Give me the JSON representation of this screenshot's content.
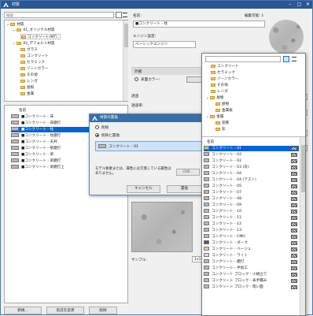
{
  "window": {
    "title": "材質",
    "minimize": "–",
    "maximize": "□",
    "close": "✕"
  },
  "search": {
    "placeholder": "検索"
  },
  "tree": {
    "items": [
      {
        "label": "材質"
      },
      {
        "label": "01_オリジナル材質"
      },
      {
        "label": "コンクリート(MT)"
      },
      {
        "label": "02_デフォルト材質"
      },
      {
        "label": "ガラス"
      },
      {
        "label": "コンクリート"
      },
      {
        "label": "セラミック"
      },
      {
        "label": "ゾーンカラー"
      },
      {
        "label": "その他"
      },
      {
        "label": "レンガ"
      },
      {
        "label": "屋根"
      },
      {
        "label": "金属"
      }
    ]
  },
  "list": {
    "header": "名前",
    "items": [
      {
        "label": "■コンクリート - 床"
      },
      {
        "label": "■コンクリート - 床磨打"
      },
      {
        "label": "■コンクリート - 柱",
        "selected": true
      },
      {
        "label": "■コンクリート - 柱磨打"
      },
      {
        "label": "■コンクリート - 天井"
      },
      {
        "label": "■コンクリート - 壁磨打"
      },
      {
        "label": "■コンクリート - 梁"
      },
      {
        "label": "■コンクリート - 梁磨打"
      },
      {
        "label": "■コンクリート - 梁磨打上"
      }
    ]
  },
  "bottom": {
    "new": "新規...",
    "rename": "名前を変更",
    "delete": "削除"
  },
  "right": {
    "name_label": "名前:",
    "name_value": "■コンクリート - 柱",
    "count_label": "編集可能: 1",
    "engine_label": "エンジン設定:",
    "engine_value": "ベーシックエンジン",
    "appearance": "外観",
    "surface_color": "表面カラー:",
    "transparency": "透過",
    "transparency_rate": "透過率:",
    "sample_label": "サンプル:",
    "sample_value": "1x1",
    "values": [
      "49",
      "72",
      "0",
      "77"
    ]
  },
  "dialog": {
    "title": "材質の置換",
    "delete_label": "削除",
    "replace_label": "削除と置換:",
    "replace_value": "コンクリート - 01",
    "note": "モデル要素または、属性には欠落している属性はありません。",
    "browse": "詳細...",
    "cancel": "キャンセル",
    "ok": "置換"
  },
  "popup": {
    "folders": [
      {
        "label": "コンクリート"
      },
      {
        "label": "セラミック"
      },
      {
        "label": "ゾーンカラー"
      },
      {
        "label": "その他"
      },
      {
        "label": "レンガ"
      },
      {
        "label": "屋根"
      },
      {
        "label": "屋根"
      },
      {
        "label": "金属板"
      },
      {
        "label": "金属"
      },
      {
        "label": "装飾"
      },
      {
        "label": "非"
      }
    ],
    "header": "名前",
    "items": [
      {
        "label": "コンクリート - 01",
        "selected": true
      },
      {
        "label": "コンクリート - 02"
      },
      {
        "label": "コンクリート - 02"
      },
      {
        "label": "コンクリート - 03 (灰)"
      },
      {
        "label": "コンクリート - 04"
      },
      {
        "label": "コンクリート - 04 (アスン)"
      },
      {
        "label": "コンクリート - 05"
      },
      {
        "label": "コンクリート - 07"
      },
      {
        "label": "コンクリート - 08"
      },
      {
        "label": "コンクリート - 09"
      },
      {
        "label": "コンクリート - 10"
      },
      {
        "label": "コンクリート - 11"
      },
      {
        "label": "コンクリート - 12"
      },
      {
        "label": "コンクリート - 13"
      },
      {
        "label": "コンクリート - CMU"
      },
      {
        "label": "コンクリート - ダーク"
      },
      {
        "label": "コンクリート - ベージュ"
      },
      {
        "label": "コンクリート - ライト"
      },
      {
        "label": "コンクリート - 磨打"
      },
      {
        "label": "コンクリート - 半加工"
      },
      {
        "label": "コンクリート ブロック - 小規立て"
      },
      {
        "label": "コンクリート ブロック - 表手積み"
      },
      {
        "label": "コンクリート ブロック - 暗い面"
      }
    ]
  },
  "colors": {
    "titlebar": "#2b5797",
    "selection": "#0a64c8"
  }
}
